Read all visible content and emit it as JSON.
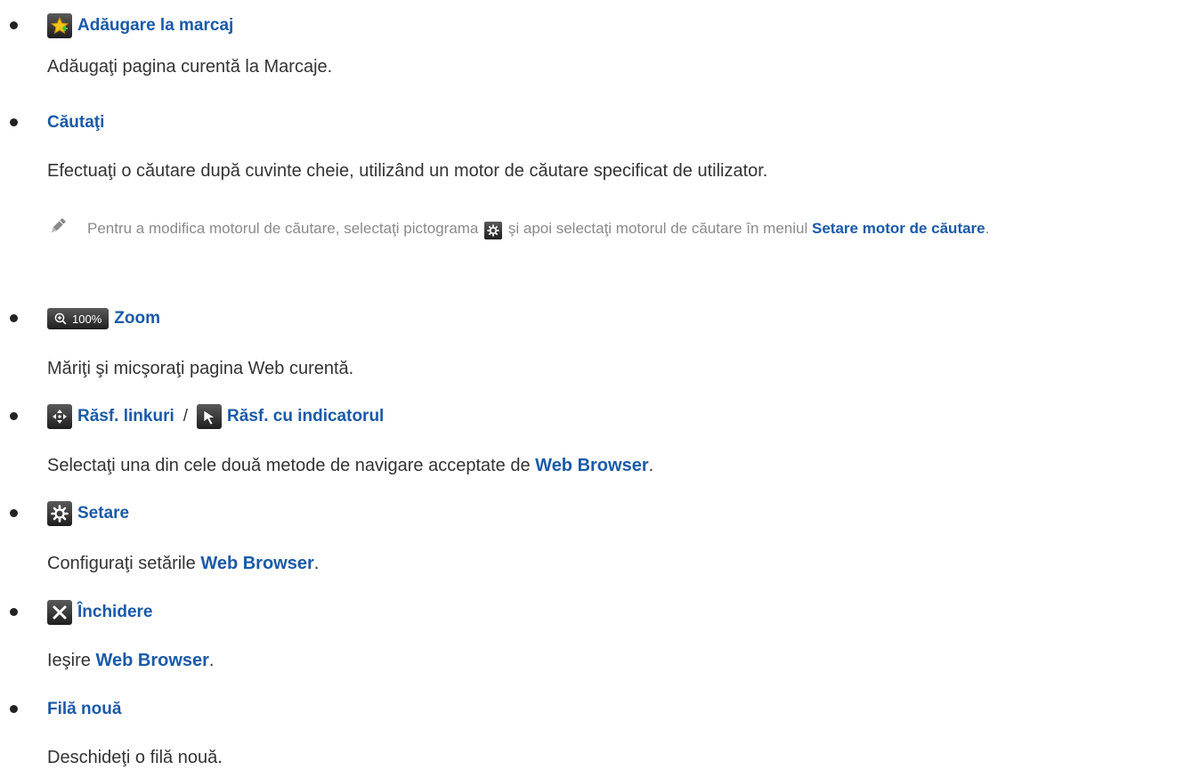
{
  "items": [
    {
      "icon": "star-bookmark-icon",
      "title": "Adăugare la marcaj",
      "desc": "Adăugaţi pagina curentă la Marcaje."
    },
    {
      "title": "Căutaţi",
      "desc": "Efectuaţi o căutare după cuvinte cheie, utilizând un motor de căutare specificat de utilizator.",
      "note": {
        "icon": "pencil-icon",
        "text_before": "Pentru a modifica motorul de căutare, selectaţi pictograma",
        "inline_icon": "gear-icon",
        "text_after": "şi apoi selectaţi motorul de căutare în meniul",
        "kw": "Setare motor de căutare",
        "end": "."
      }
    },
    {
      "icon": "zoom-icon",
      "zoom_level": "100%",
      "title": "Zoom",
      "desc": "Măriţi şi micşoraţi pagina Web curentă."
    },
    {
      "icon_a": "arrows-navigate-icon",
      "title_a": "Răsf. linkuri",
      "separator": "/",
      "icon_b": "pointer-cursor-icon",
      "title_b": "Răsf. cu indicatorul",
      "desc_before": "Selectaţi una din cele două metode de navigare acceptate de",
      "desc_kw": "Web Browser",
      "desc_end": "."
    },
    {
      "icon": "gear-icon",
      "title": "Setare",
      "desc_before": "Configuraţi setările",
      "desc_kw": "Web Browser",
      "desc_end": "."
    },
    {
      "icon": "close-icon",
      "title": "Închidere",
      "desc_before": "Ieşire",
      "desc_kw": "Web Browser",
      "desc_end": "."
    },
    {
      "title": "Filă nouă",
      "desc": "Deschideţi o filă nouă."
    }
  ]
}
